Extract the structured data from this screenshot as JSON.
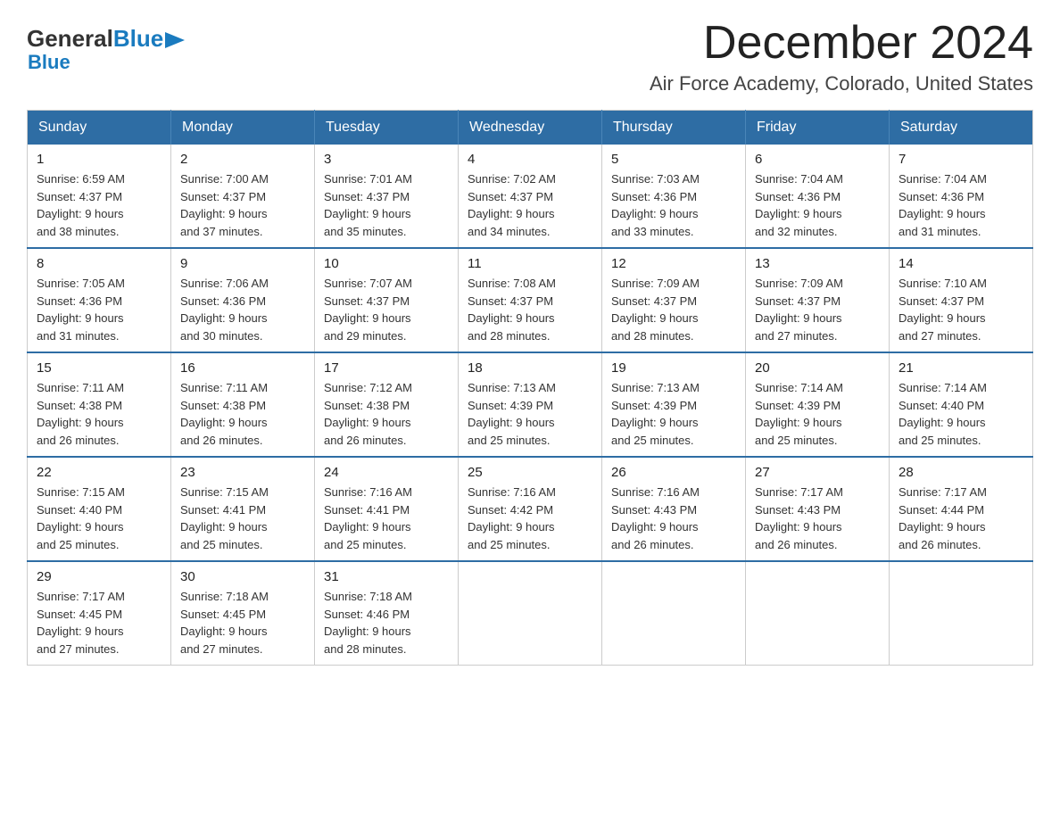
{
  "logo": {
    "general": "General",
    "blue": "Blue",
    "arrow_symbol": "▶"
  },
  "header": {
    "month_title": "December 2024",
    "location": "Air Force Academy, Colorado, United States"
  },
  "weekdays": [
    "Sunday",
    "Monday",
    "Tuesday",
    "Wednesday",
    "Thursday",
    "Friday",
    "Saturday"
  ],
  "weeks": [
    [
      {
        "day": "1",
        "sunrise": "6:59 AM",
        "sunset": "4:37 PM",
        "daylight": "9 hours and 38 minutes."
      },
      {
        "day": "2",
        "sunrise": "7:00 AM",
        "sunset": "4:37 PM",
        "daylight": "9 hours and 37 minutes."
      },
      {
        "day": "3",
        "sunrise": "7:01 AM",
        "sunset": "4:37 PM",
        "daylight": "9 hours and 35 minutes."
      },
      {
        "day": "4",
        "sunrise": "7:02 AM",
        "sunset": "4:37 PM",
        "daylight": "9 hours and 34 minutes."
      },
      {
        "day": "5",
        "sunrise": "7:03 AM",
        "sunset": "4:36 PM",
        "daylight": "9 hours and 33 minutes."
      },
      {
        "day": "6",
        "sunrise": "7:04 AM",
        "sunset": "4:36 PM",
        "daylight": "9 hours and 32 minutes."
      },
      {
        "day": "7",
        "sunrise": "7:04 AM",
        "sunset": "4:36 PM",
        "daylight": "9 hours and 31 minutes."
      }
    ],
    [
      {
        "day": "8",
        "sunrise": "7:05 AM",
        "sunset": "4:36 PM",
        "daylight": "9 hours and 31 minutes."
      },
      {
        "day": "9",
        "sunrise": "7:06 AM",
        "sunset": "4:36 PM",
        "daylight": "9 hours and 30 minutes."
      },
      {
        "day": "10",
        "sunrise": "7:07 AM",
        "sunset": "4:37 PM",
        "daylight": "9 hours and 29 minutes."
      },
      {
        "day": "11",
        "sunrise": "7:08 AM",
        "sunset": "4:37 PM",
        "daylight": "9 hours and 28 minutes."
      },
      {
        "day": "12",
        "sunrise": "7:09 AM",
        "sunset": "4:37 PM",
        "daylight": "9 hours and 28 minutes."
      },
      {
        "day": "13",
        "sunrise": "7:09 AM",
        "sunset": "4:37 PM",
        "daylight": "9 hours and 27 minutes."
      },
      {
        "day": "14",
        "sunrise": "7:10 AM",
        "sunset": "4:37 PM",
        "daylight": "9 hours and 27 minutes."
      }
    ],
    [
      {
        "day": "15",
        "sunrise": "7:11 AM",
        "sunset": "4:38 PM",
        "daylight": "9 hours and 26 minutes."
      },
      {
        "day": "16",
        "sunrise": "7:11 AM",
        "sunset": "4:38 PM",
        "daylight": "9 hours and 26 minutes."
      },
      {
        "day": "17",
        "sunrise": "7:12 AM",
        "sunset": "4:38 PM",
        "daylight": "9 hours and 26 minutes."
      },
      {
        "day": "18",
        "sunrise": "7:13 AM",
        "sunset": "4:39 PM",
        "daylight": "9 hours and 25 minutes."
      },
      {
        "day": "19",
        "sunrise": "7:13 AM",
        "sunset": "4:39 PM",
        "daylight": "9 hours and 25 minutes."
      },
      {
        "day": "20",
        "sunrise": "7:14 AM",
        "sunset": "4:39 PM",
        "daylight": "9 hours and 25 minutes."
      },
      {
        "day": "21",
        "sunrise": "7:14 AM",
        "sunset": "4:40 PM",
        "daylight": "9 hours and 25 minutes."
      }
    ],
    [
      {
        "day": "22",
        "sunrise": "7:15 AM",
        "sunset": "4:40 PM",
        "daylight": "9 hours and 25 minutes."
      },
      {
        "day": "23",
        "sunrise": "7:15 AM",
        "sunset": "4:41 PM",
        "daylight": "9 hours and 25 minutes."
      },
      {
        "day": "24",
        "sunrise": "7:16 AM",
        "sunset": "4:41 PM",
        "daylight": "9 hours and 25 minutes."
      },
      {
        "day": "25",
        "sunrise": "7:16 AM",
        "sunset": "4:42 PM",
        "daylight": "9 hours and 25 minutes."
      },
      {
        "day": "26",
        "sunrise": "7:16 AM",
        "sunset": "4:43 PM",
        "daylight": "9 hours and 26 minutes."
      },
      {
        "day": "27",
        "sunrise": "7:17 AM",
        "sunset": "4:43 PM",
        "daylight": "9 hours and 26 minutes."
      },
      {
        "day": "28",
        "sunrise": "7:17 AM",
        "sunset": "4:44 PM",
        "daylight": "9 hours and 26 minutes."
      }
    ],
    [
      {
        "day": "29",
        "sunrise": "7:17 AM",
        "sunset": "4:45 PM",
        "daylight": "9 hours and 27 minutes."
      },
      {
        "day": "30",
        "sunrise": "7:18 AM",
        "sunset": "4:45 PM",
        "daylight": "9 hours and 27 minutes."
      },
      {
        "day": "31",
        "sunrise": "7:18 AM",
        "sunset": "4:46 PM",
        "daylight": "9 hours and 28 minutes."
      },
      null,
      null,
      null,
      null
    ]
  ]
}
